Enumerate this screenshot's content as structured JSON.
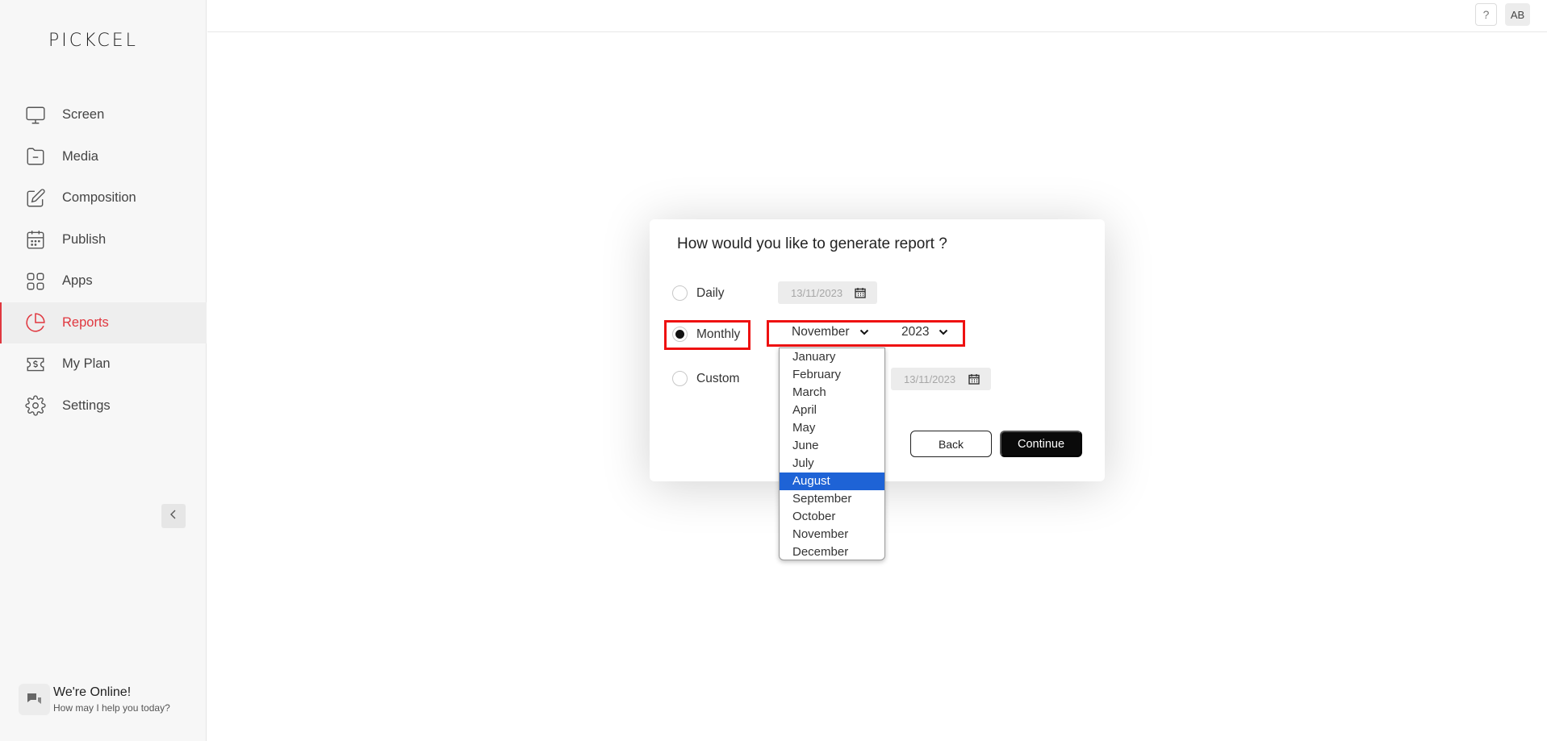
{
  "brand": {
    "logo_text": "PICKCEL"
  },
  "sidebar": {
    "items": [
      {
        "label": "Screen",
        "icon": "monitor-icon",
        "active": false
      },
      {
        "label": "Media",
        "icon": "folder-icon",
        "active": false
      },
      {
        "label": "Composition",
        "icon": "edit-icon",
        "active": false
      },
      {
        "label": "Publish",
        "icon": "calendar-icon",
        "active": false
      },
      {
        "label": "Apps",
        "icon": "grid-icon",
        "active": false
      },
      {
        "label": "Reports",
        "icon": "pie-chart-icon",
        "active": true
      },
      {
        "label": "My Plan",
        "icon": "dollar-ticket-icon",
        "active": false
      },
      {
        "label": "Settings",
        "icon": "gear-icon",
        "active": false
      }
    ],
    "collapse_icon": "chevron-left-icon",
    "accent_color": "#e0373f"
  },
  "chat": {
    "title": "We're Online!",
    "subtitle": "How may I help you today?",
    "icon": "chat-bubbles-icon"
  },
  "topbar": {
    "help_label": "?",
    "avatar_initials": "AB"
  },
  "modal": {
    "title": "How would you like to generate report ?",
    "options": {
      "daily": {
        "label": "Daily",
        "checked": false,
        "date": "13/11/2023"
      },
      "monthly": {
        "label": "Monthly",
        "checked": true,
        "month": "November",
        "year": "2023"
      },
      "custom": {
        "label": "Custom",
        "checked": false,
        "date": "13/11/2023"
      }
    },
    "back_label": "Back",
    "continue_label": "Continue"
  },
  "month_dropdown": {
    "options": [
      "January",
      "February",
      "March",
      "April",
      "May",
      "June",
      "July",
      "August",
      "September",
      "October",
      "November",
      "December"
    ],
    "highlighted": "August",
    "highlight_color": "#1e63d6"
  }
}
